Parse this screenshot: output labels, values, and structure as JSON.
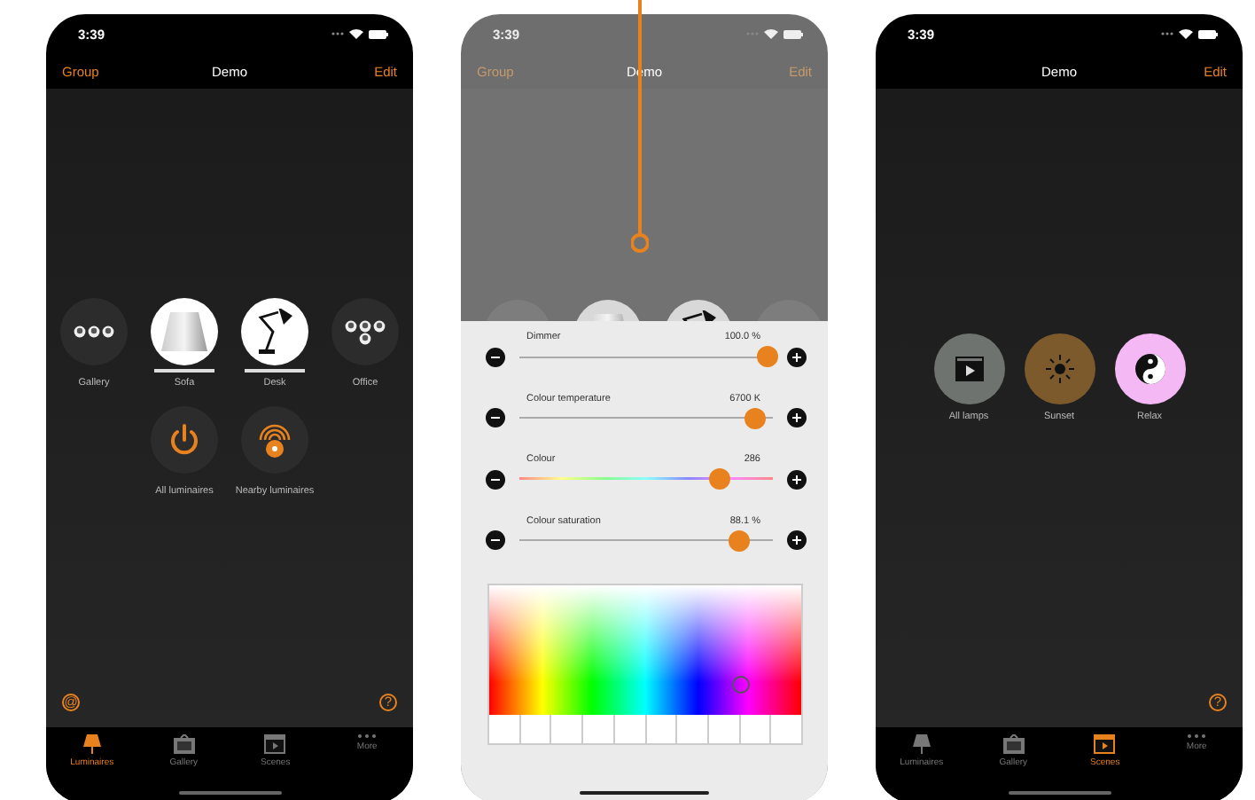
{
  "phones": [
    {
      "kind": "luminaires",
      "time": "3:39",
      "nav": {
        "left": "Group",
        "title": "Demo",
        "right": "Edit"
      },
      "luminaires": [
        {
          "kind": "bulbs",
          "label": "Gallery",
          "selected": false
        },
        {
          "kind": "shade",
          "label": "Sofa",
          "selected": true
        },
        {
          "kind": "desk",
          "label": "Desk",
          "selected": true
        },
        {
          "kind": "office",
          "label": "Office",
          "selected": false
        }
      ],
      "actions": [
        {
          "kind": "power",
          "label": "All luminaires"
        },
        {
          "kind": "nearby",
          "label": "Nearby luminaires"
        }
      ],
      "corner_left": "@",
      "corner_right": "?",
      "tabs": [
        {
          "kind": "lamp",
          "label": "Luminaires",
          "selected": true
        },
        {
          "kind": "gallery",
          "label": "Gallery",
          "selected": false
        },
        {
          "kind": "scenes",
          "label": "Scenes",
          "selected": false
        },
        {
          "kind": "more",
          "label": "More",
          "selected": false
        }
      ]
    },
    {
      "kind": "controls",
      "time": "3:39",
      "nav": {
        "left": "Group",
        "title": "Demo",
        "right": "Edit"
      },
      "luminaires": [
        {
          "kind": "bulbs",
          "selected": false
        },
        {
          "kind": "shade",
          "selected": true
        },
        {
          "kind": "desk",
          "selected": true
        },
        {
          "kind": "bulbs",
          "selected": false
        }
      ],
      "sliders": [
        {
          "kind": "plain",
          "label": "Dimmer",
          "reading": "100.0 %",
          "level": 0.98
        },
        {
          "kind": "plain",
          "label": "Colour temperature",
          "reading": "6700 K",
          "level": 0.93
        },
        {
          "kind": "hue",
          "label": "Colour",
          "reading": "286",
          "level": 0.79
        },
        {
          "kind": "plain",
          "label": "Colour saturation",
          "reading": "88.1 %",
          "level": 0.87
        }
      ]
    },
    {
      "kind": "scenes",
      "time": "3:39",
      "nav": {
        "title": "Demo",
        "right": "Edit"
      },
      "scenes": [
        {
          "kind": "clip",
          "label": "All lamps",
          "color": "#6f7370"
        },
        {
          "kind": "sun",
          "label": "Sunset",
          "color": "#7d5a2c"
        },
        {
          "kind": "yinyang",
          "label": "Relax",
          "color": "#f4b8f4"
        }
      ],
      "corner_right": "?",
      "tabs": [
        {
          "kind": "lamp",
          "label": "Luminaires",
          "selected": false
        },
        {
          "kind": "gallery",
          "label": "Gallery",
          "selected": false
        },
        {
          "kind": "scenes",
          "label": "Scenes",
          "selected": true
        },
        {
          "kind": "more",
          "label": "More",
          "selected": false
        }
      ]
    }
  ]
}
